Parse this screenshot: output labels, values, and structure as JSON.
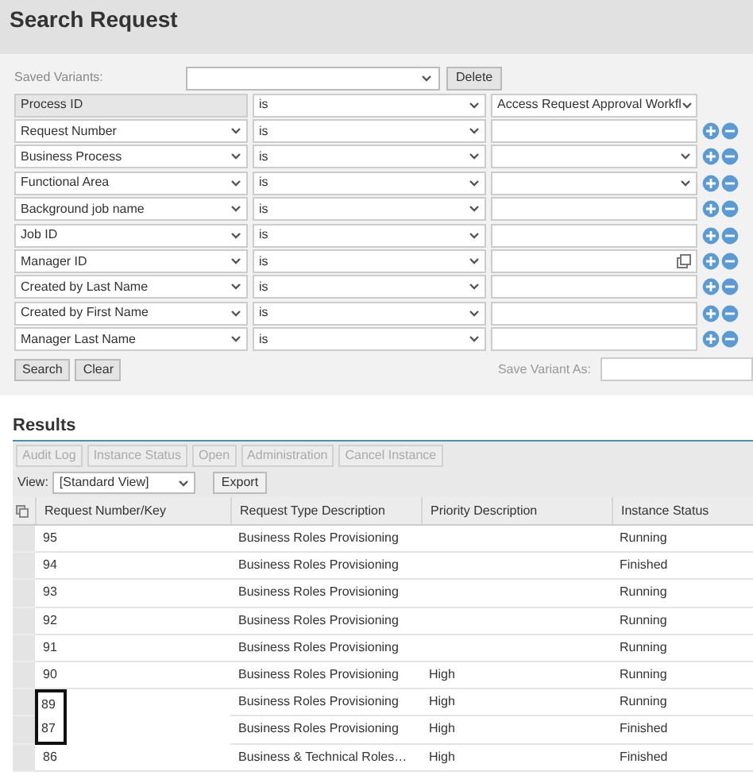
{
  "title": "Search Request",
  "saved_variants": {
    "label": "Saved Variants:",
    "delete_button": "Delete"
  },
  "criteria": [
    {
      "field": "Process ID",
      "field_locked": true,
      "operator": "is",
      "value": "Access Request Approval Workfl",
      "kind": "select",
      "row_actions": false
    },
    {
      "field": "Request Number",
      "field_locked": false,
      "operator": "is",
      "kind": "text",
      "row_actions": true
    },
    {
      "field": "Business Process",
      "field_locked": false,
      "operator": "is",
      "kind": "select",
      "row_actions": true
    },
    {
      "field": "Functional Area",
      "field_locked": false,
      "operator": "is",
      "kind": "select",
      "row_actions": true
    },
    {
      "field": "Background job name",
      "field_locked": false,
      "operator": "is",
      "kind": "text",
      "row_actions": true
    },
    {
      "field": "Job ID",
      "field_locked": false,
      "operator": "is",
      "kind": "text",
      "row_actions": true
    },
    {
      "field": "Manager ID",
      "field_locked": false,
      "operator": "is",
      "kind": "lookup",
      "row_actions": true
    },
    {
      "field": "Created by Last Name",
      "field_locked": false,
      "operator": "is",
      "kind": "text",
      "row_actions": true
    },
    {
      "field": "Created by  First Name",
      "field_locked": false,
      "operator": "is",
      "kind": "text",
      "row_actions": true
    },
    {
      "field": "Manager Last Name",
      "field_locked": false,
      "operator": "is",
      "kind": "text",
      "row_actions": true
    }
  ],
  "buttons": [
    "Search",
    "Clear"
  ],
  "save_variant_label": "Save Variant As:",
  "results": {
    "heading": "Results",
    "toolbar": [
      {
        "label": "Audit Log",
        "disabled": true
      },
      {
        "label": "Instance Status",
        "disabled": true
      },
      {
        "label": "Open",
        "disabled": true
      },
      {
        "label": "Administration",
        "disabled": true
      },
      {
        "label": "Cancel Instance",
        "disabled": true
      }
    ],
    "view_label": "View:",
    "view_value": "[Standard View]",
    "export_button": "Export",
    "columns": [
      "Request Number/Key",
      "Request Type Description",
      "Priority Description",
      "Instance Status"
    ],
    "rows": [
      {
        "cells": [
          "95",
          "Business Roles Provisioning",
          "",
          "Running"
        ],
        "outlined": false
      },
      {
        "cells": [
          "94",
          "Business Roles Provisioning",
          "",
          "Finished"
        ],
        "outlined": false
      },
      {
        "cells": [
          "93",
          "Business Roles Provisioning",
          "",
          "Running"
        ],
        "outlined": false
      },
      {
        "cells": [
          "92",
          "Business Roles Provisioning",
          "",
          "Running"
        ],
        "outlined": false
      },
      {
        "cells": [
          "91",
          "Business Roles Provisioning",
          "",
          "Running"
        ],
        "outlined": false
      },
      {
        "cells": [
          "90",
          "Business Roles Provisioning",
          "High",
          "Running"
        ],
        "outlined": false
      },
      {
        "cells": [
          "89",
          "Business Roles Provisioning",
          "High",
          "Running"
        ],
        "outlined": true
      },
      {
        "cells": [
          "87",
          "Business Roles Provisioning",
          "High",
          "Finished"
        ],
        "outlined": true
      },
      {
        "cells": [
          "86",
          "Business & Technical Roles…",
          "High",
          "Finished"
        ],
        "outlined": false
      }
    ]
  }
}
